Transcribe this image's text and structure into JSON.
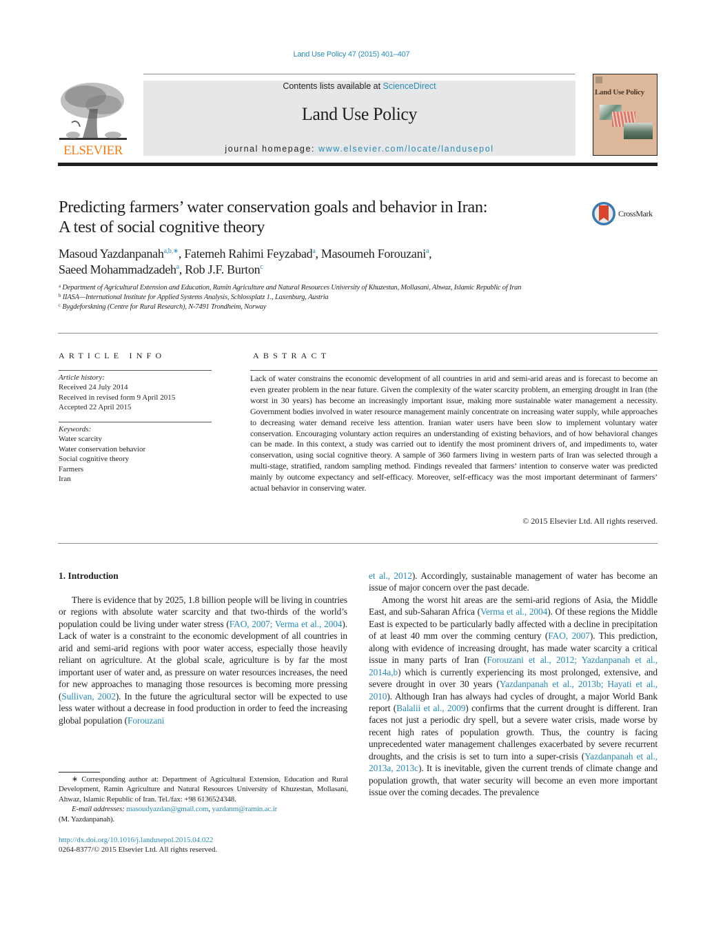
{
  "header": {
    "running_head": "Land Use Policy 47 (2015) 401–407",
    "publisher_wordmark": "ELSEVIER",
    "contents_prefix": "Contents lists available at ",
    "contents_link": "ScienceDirect",
    "journal_name": "Land Use Policy",
    "homepage_prefix": "journal homepage: ",
    "homepage_link": "www.elsevier.com/locate/landusepol",
    "cover_title": "Land Use Policy",
    "colors": {
      "link": "#2a8ab5",
      "elsevier_orange": "#f07f1b",
      "masthead_bg": "#e6e7e8",
      "cover_bg": "#dcb79a"
    }
  },
  "article": {
    "title_line1": "Predicting farmers’ water conservation goals and behavior in Iran:",
    "title_line2": "A test of social cognitive theory",
    "crossmark_label": "CrossMark",
    "authors": [
      {
        "name": "Masoud Yazdanpanah",
        "sup": "a,b,∗",
        "sep": ", "
      },
      {
        "name": "Fatemeh Rahimi Feyzabad",
        "sup": "a",
        "sep": ", "
      },
      {
        "name": "Masoumeh Forouzani",
        "sup": "a",
        "sep": ","
      },
      {
        "name": "Saeed Mohammadzadeh",
        "sup": "a",
        "sep": ", "
      },
      {
        "name": "Rob J.F. Burton",
        "sup": "c",
        "sep": ""
      }
    ],
    "affiliations": [
      {
        "mark": "a",
        "text": "Department of Agricultural Extension and Education, Ramin Agriculture and Natural Resources University of Khuzestan, Mollasani, Ahwaz, Islamic Republic of Iran"
      },
      {
        "mark": "b",
        "text": "IIASA—International Institute for Applied Systems Analysis, Schlossplatz 1., Laxenburg, Austria"
      },
      {
        "mark": "c",
        "text": "Bygdeforskning (Centre for Rural Research), N-7491 Trondheim, Norway"
      }
    ]
  },
  "article_info": {
    "heading": "ARTICLE INFO",
    "history_label": "Article history:",
    "history": [
      "Received 24 July 2014",
      "Received in revised form 9 April 2015",
      "Accepted 22 April 2015"
    ],
    "keywords_label": "Keywords:",
    "keywords": [
      "Water scarcity",
      "Water conservation behavior",
      "Social cognitive theory",
      "Farmers",
      "Iran"
    ]
  },
  "abstract": {
    "heading": "ABSTRACT",
    "text": "Lack of water constrains the economic development of all countries in arid and semi-arid areas and is forecast to become an even greater problem in the near future. Given the complexity of the water scarcity problem, an emerging drought in Iran (the worst in 30 years) has become an increasingly important issue, making more sustainable water management a necessity. Government bodies involved in water resource management mainly concentrate on increasing water supply, while approaches to decreasing water demand receive less attention. Iranian water users have been slow to implement voluntary water conservation. Encouraging voluntary action requires an understanding of existing behaviors, and of how behavioral changes can be made. In this context, a study was carried out to identify the most prominent drivers of, and impediments to, water conservation, using social cognitive theory. A sample of 360 farmers living in western parts of Iran was selected through a multi-stage, stratified, random sampling method. Findings revealed that farmers’ intention to conserve water was predicted mainly by outcome expectancy and self-efficacy. Moreover, self-efficacy was the most important determinant of farmers’ actual behavior in conserving water.",
    "copyright": "© 2015 Elsevier Ltd. All rights reserved."
  },
  "body": {
    "section_heading": "1.  Introduction",
    "left_p1": [
      {
        "t": "There is evidence that by 2025, 1.8 billion people will be living in countries or regions with absolute water scarcity and that two-thirds of the world’s population could be living under water stress ("
      },
      {
        "t": "FAO, 2007; Verma et al., 2004",
        "link": true
      },
      {
        "t": "). Lack of water is a constraint to the economic development of all countries in arid and semi-arid regions with poor water access, especially those heavily reliant on agriculture. At the global scale, agriculture is by far the most important user of water and, as pressure on water resources increases, the need for new approaches to managing those resources is becoming more pressing ("
      },
      {
        "t": "Sullivan, 2002",
        "link": true
      },
      {
        "t": "). In the future the agricultural sector will be expected to use less water without a decrease in food production in order to feed the increasing global population ("
      },
      {
        "t": "Forouzani",
        "link": true
      }
    ],
    "right_p1": [
      {
        "t": "et al., 2012",
        "link": true
      },
      {
        "t": "). Accordingly, sustainable management of water has become an issue of major concern over the past decade."
      }
    ],
    "right_p2": [
      {
        "t": "Among the worst hit areas are the semi-arid regions of Asia, the Middle East, and sub-Saharan Africa ("
      },
      {
        "t": "Verma et al., 2004",
        "link": true
      },
      {
        "t": "). Of these regions the Middle East is expected to be particularly badly affected with a decline in precipitation of at least 40 mm over the comming century ("
      },
      {
        "t": "FAO, 2007",
        "link": true
      },
      {
        "t": "). This prediction, along with evidence of increasing drought, has made water scarcity a critical issue in many parts of Iran ("
      },
      {
        "t": "Forouzani et al., 2012; Yazdanpanah et al., 2014a,b",
        "link": true
      },
      {
        "t": ") which is currently experiencing its most prolonged, extensive, and severe drought in over 30 years ("
      },
      {
        "t": "Yazdanpanah et al., 2013b; Hayati et al., 2010",
        "link": true
      },
      {
        "t": "). Although Iran has always had cycles of drought, a major World Bank report ("
      },
      {
        "t": "Balalii et al., 2009",
        "link": true
      },
      {
        "t": ") confirms that the current drought is different. Iran faces not just a periodic dry spell, but a severe water crisis, made worse by recent high rates of population growth. Thus, the country is facing unprecedented water management challenges exacerbated by severe recurrent droughts, and the crisis is set to turn into a super-crisis ("
      },
      {
        "t": "Yazdanpanah et al., 2013a, 2013c",
        "link": true
      },
      {
        "t": "). It is inevitable, given the current trends of climate change and population growth, that water security will become an even more important issue over the coming decades. The prevalence"
      }
    ]
  },
  "footnote": {
    "star": "∗",
    "corresponding": " Corresponding author at: Department of Agricultural Extension, Education and Rural Development, Ramin Agriculture and Natural Resources University of Khuzestan, Mollasani, Ahwaz, Islamic Republic of Iran. Tel./fax: +98 6136524348.",
    "email_label": "E-mail addresses: ",
    "email1": "masoudyazdan@gmail.com",
    "email_sep": ", ",
    "email2": "yazdanm@ramin.ac.ir",
    "email_owner": "(M. Yazdanpanah).",
    "doi": "http://dx.doi.org/10.1016/j.landusepol.2015.04.022",
    "issn_line": "0264-8377/© 2015 Elsevier Ltd. All rights reserved."
  }
}
